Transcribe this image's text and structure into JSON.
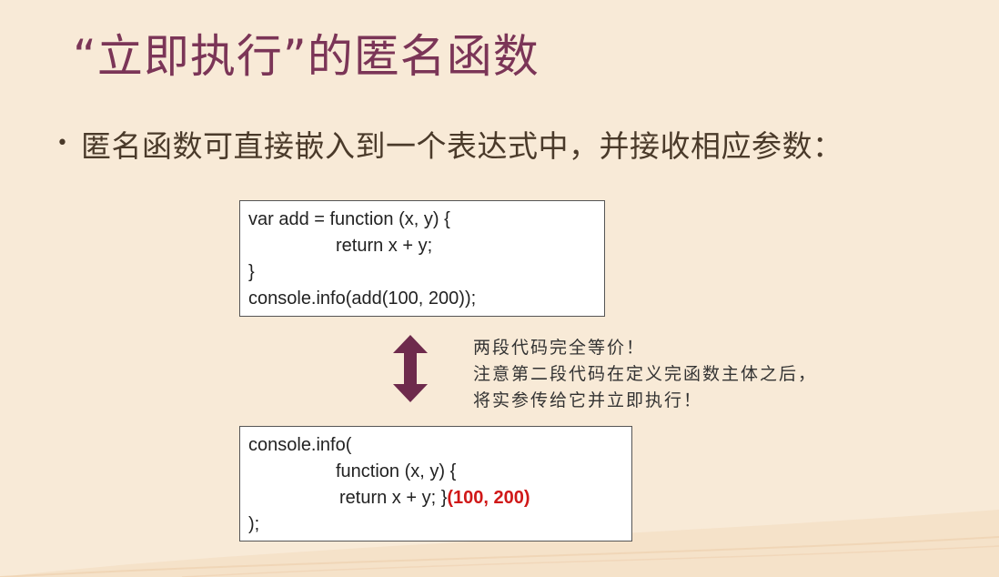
{
  "slide": {
    "title": "“立即执行”的匿名函数",
    "bullet": {
      "dot": "•",
      "text": "匿名函数可直接嵌入到一个表达式中，并接收相应参数："
    }
  },
  "code_block_1": {
    "lines": [
      "var add = function (x, y) {",
      "return x + y;",
      "}",
      "console.info(add(100, 200));"
    ]
  },
  "code_block_2": {
    "line1": "console.info(",
    "line2": "function (x, y) {",
    "line3_code": "return x + y; }",
    "line3_args": "(100, 200)",
    "line4": ");"
  },
  "note": {
    "lines": [
      "两段代码完全等价！",
      "注意第二段代码在定义完函数主体之后，",
      "将实参传给它并立即执行！"
    ]
  },
  "colors": {
    "background": "#f8ead7",
    "title": "#7b3557",
    "arrow": "#6e2a4c",
    "highlight": "#d01818"
  },
  "icons": {
    "arrow": "double-headed-vertical-arrow"
  }
}
